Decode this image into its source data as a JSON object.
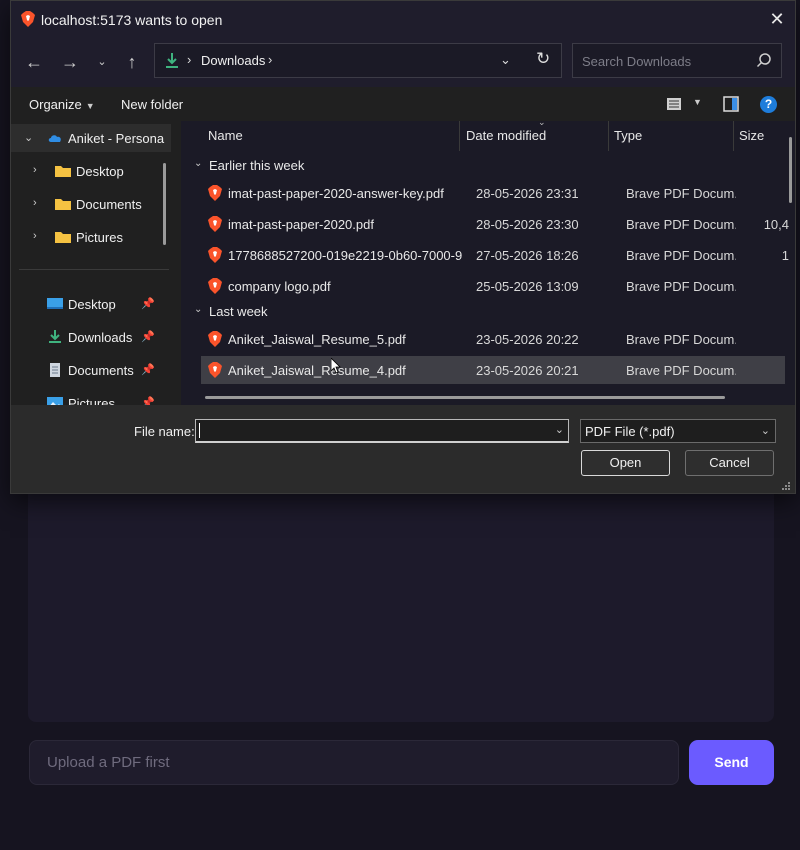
{
  "dialog": {
    "title": "localhost:5173 wants to open",
    "icons": {
      "app": "brave-icon",
      "close": "close-icon"
    }
  },
  "nav": {
    "address_folder": "Downloads",
    "search_placeholder": "Search Downloads",
    "icons": {
      "back": "back-arrow-icon",
      "forward": "forward-arrow-icon",
      "recent": "chevron-down-icon",
      "up": "up-arrow-icon",
      "refresh": "refresh-icon",
      "search": "search-icon"
    }
  },
  "toolbar": {
    "organize": "Organize",
    "new_folder": "New folder",
    "icons": {
      "view": "list-view-icon",
      "preview_pane": "preview-pane-icon",
      "help": "help-icon"
    },
    "help_label": "?"
  },
  "sidebar": {
    "tree": [
      {
        "label": "Aniket - Persona",
        "icon": "onedrive-icon",
        "expanded": true
      },
      {
        "label": "Desktop",
        "icon": "folder-icon"
      },
      {
        "label": "Documents",
        "icon": "folder-icon"
      },
      {
        "label": "Pictures",
        "icon": "folder-icon"
      }
    ],
    "quick_access": [
      {
        "label": "Desktop",
        "icon": "desktop-icon",
        "pinned": true
      },
      {
        "label": "Downloads",
        "icon": "download-icon",
        "pinned": true
      },
      {
        "label": "Documents",
        "icon": "document-icon",
        "pinned": true
      },
      {
        "label": "Pictures",
        "icon": "pictures-icon",
        "pinned": true
      }
    ]
  },
  "filelist": {
    "columns": [
      "Name",
      "Date modified",
      "Type",
      "Size"
    ],
    "groups": [
      {
        "label": "Earlier this week",
        "files": [
          {
            "name": "imat-past-paper-2020-answer-key.pdf",
            "date": "28-05-2026 23:31",
            "type": "Brave PDF Docum...",
            "size": ""
          },
          {
            "name": "imat-past-paper-2020.pdf",
            "date": "28-05-2026 23:30",
            "type": "Brave PDF Docum...",
            "size": "10,4"
          },
          {
            "name": "1778688527200-019e2219-0b60-7000-9...",
            "date": "27-05-2026 18:26",
            "type": "Brave PDF Docum...",
            "size": "1"
          },
          {
            "name": "company logo.pdf",
            "date": "25-05-2026 13:09",
            "type": "Brave PDF Docum...",
            "size": ""
          }
        ]
      },
      {
        "label": "Last week",
        "files": [
          {
            "name": "Aniket_Jaiswal_Resume_5.pdf",
            "date": "23-05-2026 20:22",
            "type": "Brave PDF Docum...",
            "size": ""
          },
          {
            "name": "Aniket_Jaiswal_Resume_4.pdf",
            "date": "23-05-2026 20:21",
            "type": "Brave PDF Docum...",
            "size": "",
            "selected": true
          }
        ]
      }
    ],
    "file_icon": "pdf-file-icon"
  },
  "bottom": {
    "file_name_label": "File name:",
    "file_name_value": "",
    "file_type": "PDF File (*.pdf)",
    "open": "Open",
    "cancel": "Cancel"
  },
  "app": {
    "input_placeholder": "Upload a PDF first",
    "send": "Send",
    "colors": {
      "accent": "#6b5bff",
      "background": "#161420"
    }
  }
}
